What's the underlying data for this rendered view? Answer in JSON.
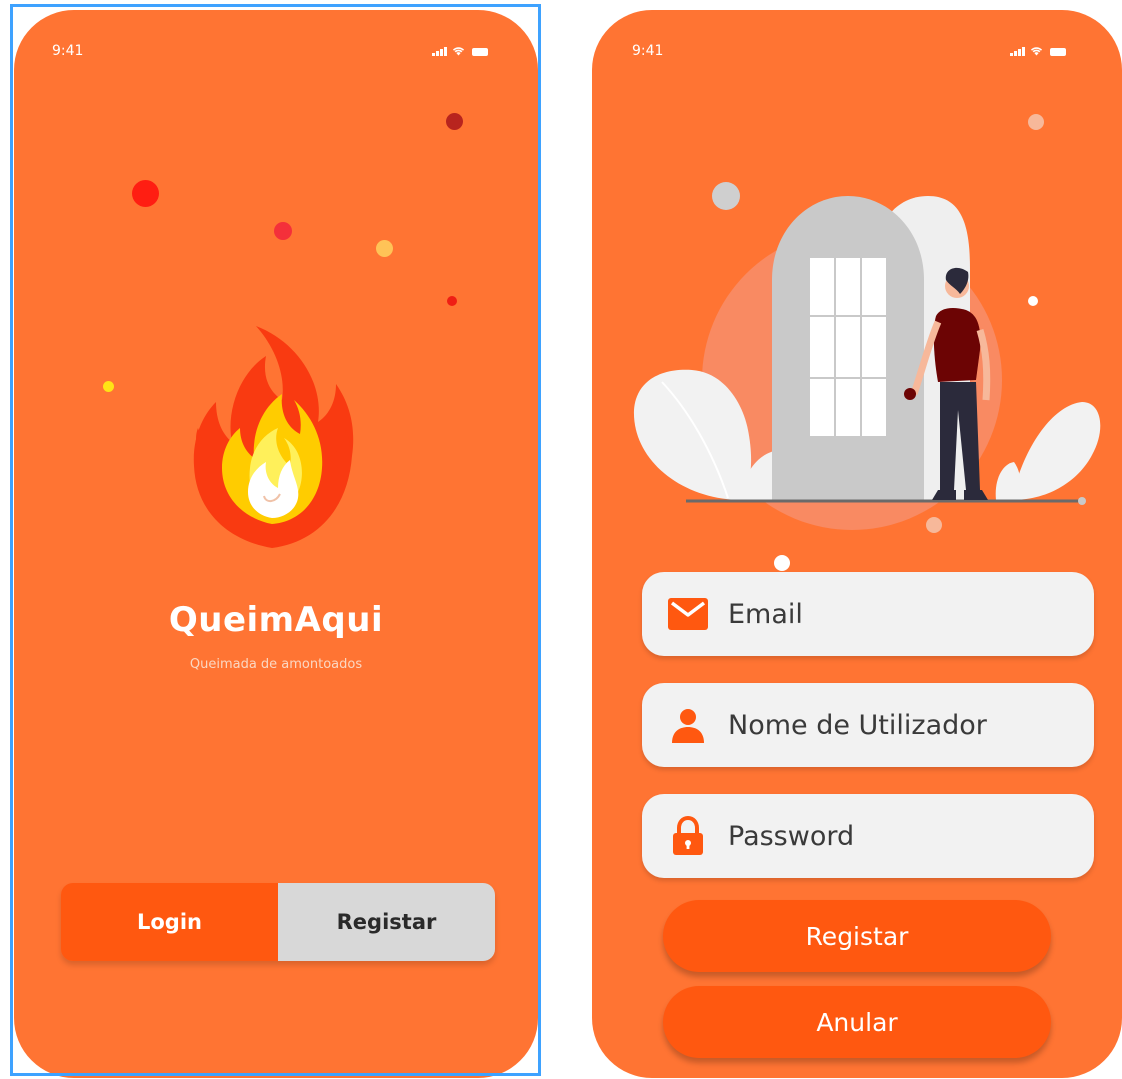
{
  "status_bar": {
    "time": "9:41"
  },
  "splash": {
    "app_name": "QueimAqui",
    "tagline": "Queimada de amontoados",
    "tabs": [
      {
        "label": "Login",
        "active": true
      },
      {
        "label": "Registar",
        "active": false
      }
    ],
    "logo_icon": "fire-icon"
  },
  "register_form": {
    "illustration": "person-at-door-illustration",
    "fields": [
      {
        "placeholder": "Email",
        "value": "",
        "icon": "envelope-icon"
      },
      {
        "placeholder": "Nome de Utilizador",
        "value": "",
        "icon": "user-icon"
      },
      {
        "placeholder": "Password",
        "value": "",
        "icon": "lock-icon"
      }
    ],
    "submit_label": "Registar",
    "cancel_label": "Anular"
  },
  "colors": {
    "background": "#ff7433",
    "accent": "#ff5810",
    "field": "#f2f2f2",
    "toggle_inactive": "#d8d8d8"
  }
}
